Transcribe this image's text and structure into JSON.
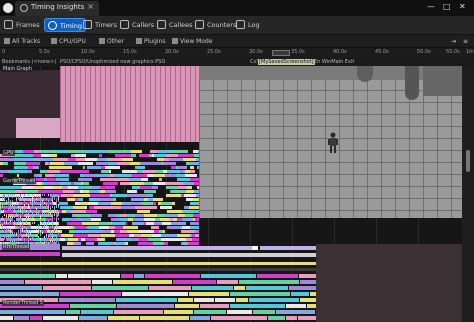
{
  "window": {
    "tab_title": "Timing Insights",
    "close_glyph": "×",
    "controls": [
      "—",
      "□",
      "✕"
    ]
  },
  "toolbar": {
    "buttons": [
      {
        "label": "Frames",
        "icon": "frames-icon"
      },
      {
        "label": "Timing",
        "icon": "timing-icon",
        "active": true
      },
      {
        "label": "Timers",
        "icon": "timers-icon"
      },
      {
        "label": "Callers",
        "icon": "callers-icon"
      },
      {
        "label": "Callees",
        "icon": "callees-icon"
      },
      {
        "label": "Counters",
        "icon": "counters-icon"
      },
      {
        "label": "Log",
        "icon": "log-icon"
      }
    ]
  },
  "filters": {
    "all_tracks": "All Tracks",
    "cpu_gpu": "CPU/GPU",
    "other": "Other",
    "plugins": "Plugins",
    "view_mode": "View Mode"
  },
  "ruler": {
    "ticks": [
      "0",
      "5.0s",
      "10.0s",
      "15.0s",
      "20.0s",
      "25.0s",
      "30.0s",
      "35.0s",
      "40.0s",
      "45.0s",
      "50.0s",
      "55.0s",
      "1m"
    ]
  },
  "bookmarks": {
    "items": [
      "Bookmarks (<none>)",
      "PSO/CPSO/Unoptimized new graphics PSO",
      "Cs!",
      "[MySavedScreenshot]",
      "En WinMain Exit"
    ],
    "main_graph": "Main Graph"
  },
  "tracks": {
    "gpu": "GPU",
    "game_thread": "GameThread",
    "rhi_thread": "RHIThread",
    "render_thread": "RenderThread 5"
  },
  "colors": {
    "accent": "#0f5fbf",
    "pink": "#e89cc0",
    "magenta": "#cf3fc9",
    "yellow": "#e3e07a",
    "cyan": "#56c7d8",
    "green": "#66d2a4",
    "lavender": "#a08ad8"
  }
}
